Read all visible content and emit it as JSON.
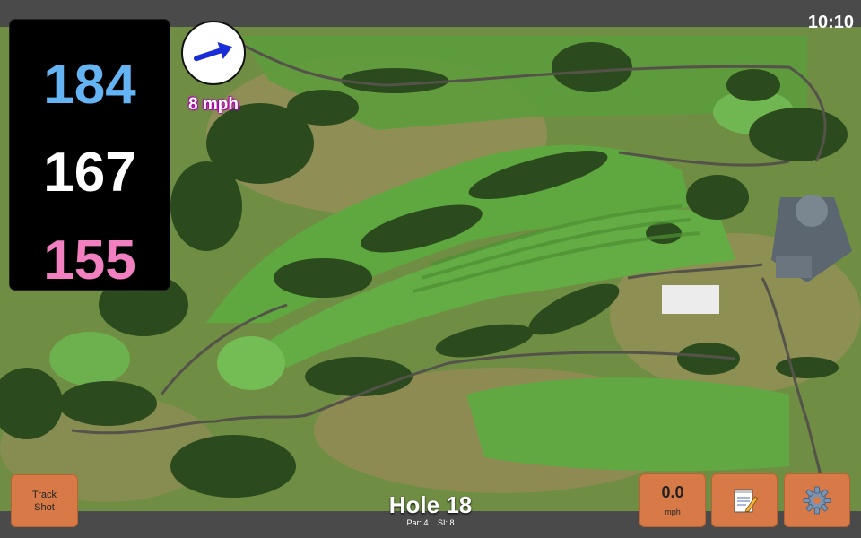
{
  "status": {
    "time": "10:10"
  },
  "distances": {
    "back": "184",
    "middle": "167",
    "front": "155"
  },
  "wind": {
    "speed_label": "8 mph"
  },
  "hole": {
    "title": "Hole 18",
    "par": "Par: 4",
    "si": "SI: 8"
  },
  "buttons": {
    "track_shot_line1": "Track",
    "track_shot_line2": "Shot",
    "speed_value": "0.0",
    "speed_unit": "mph",
    "notes_icon": "notepad-icon",
    "settings_icon": "gear-icon"
  },
  "colors": {
    "back": "#64b4f4",
    "middle": "#ffffff",
    "front": "#f27fc0",
    "button": "#d77a47",
    "wind_arrow": "#1a2bd8"
  }
}
